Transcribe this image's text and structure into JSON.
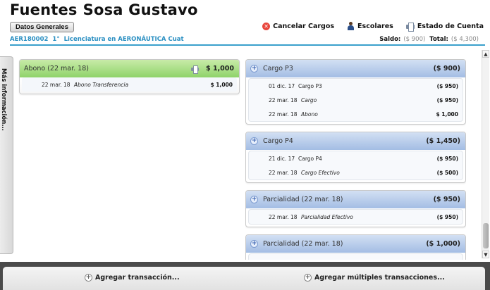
{
  "header": {
    "first_name": "Fuentes",
    "last_name": "Sosa Gustavo",
    "datos_button": "Datos Generales",
    "student_id": "AER180002",
    "grade": "1°",
    "program": "Licenciatura en AERONÁUTICA Cuat",
    "actions": {
      "cancel": "Cancelar Cargos",
      "escolares": "Escolares",
      "estado": "Estado de Cuenta"
    },
    "saldo_label": "Saldo:",
    "saldo_value": "($ 900)",
    "total_label": "Total:",
    "total_value": "($ 4,300)"
  },
  "side_tab": {
    "label": "Más información..."
  },
  "left_cards": [
    {
      "title": "Abono (22 mar. 18)",
      "amount": "$ 1,000",
      "rows": [
        {
          "date": "22 mar. 18",
          "category": "",
          "desc": "Abono  Transferencia",
          "amount": "$ 1,000"
        }
      ]
    }
  ],
  "right_cards": [
    {
      "title": "Cargo P3",
      "amount": "($ 900)",
      "rows": [
        {
          "date": "01 dic. 17",
          "category": "Cargo P3",
          "desc": "",
          "amount": "($ 950)"
        },
        {
          "date": "22 mar. 18",
          "category": "",
          "desc": "Cargo",
          "amount": "($ 950)"
        },
        {
          "date": "22 mar. 18",
          "category": "",
          "desc": "Abono",
          "amount": "$ 1,000"
        }
      ]
    },
    {
      "title": "Cargo P4",
      "amount": "($ 1,450)",
      "rows": [
        {
          "date": "21 dic. 17",
          "category": "Cargo P4",
          "desc": "",
          "amount": "($ 950)"
        },
        {
          "date": "22 mar. 18",
          "category": "",
          "desc": "Cargo Efectivo",
          "amount": "($ 500)"
        }
      ]
    },
    {
      "title": "Parcialidad (22 mar. 18)",
      "amount": "($ 950)",
      "rows": [
        {
          "date": "22 mar. 18",
          "category": "",
          "desc": "Parcialidad Efectivo",
          "amount": "($ 950)"
        }
      ]
    },
    {
      "title": "Parcialidad (22 mar. 18)",
      "amount": "($ 1,000)",
      "rows": []
    }
  ],
  "bottom": {
    "add_transaction": "Agregar transacción...",
    "add_multiple": "Agregar múltiples transacciones..."
  }
}
